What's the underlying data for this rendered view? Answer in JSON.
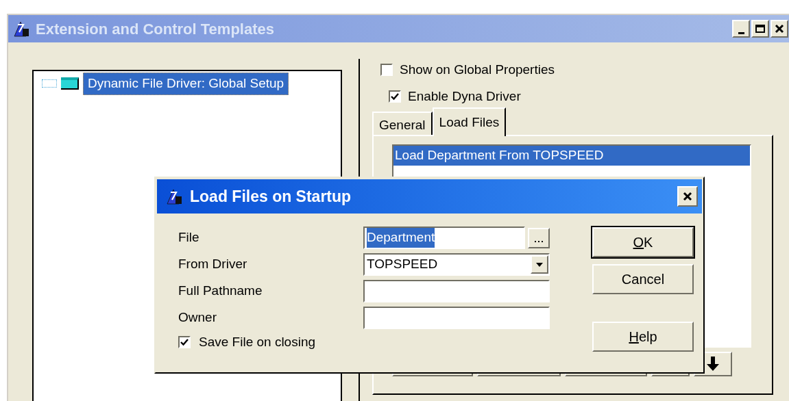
{
  "main_window": {
    "title": "Extension and Control Templates"
  },
  "tree": {
    "items": [
      {
        "label": "Dynamic File Driver: Global Setup",
        "selected": true
      }
    ]
  },
  "options": [
    {
      "label": "Show on Global Properties",
      "checked": false
    },
    {
      "label": "Enable Dyna Driver",
      "checked": true
    }
  ],
  "tabs": [
    {
      "label": "General",
      "selected": false
    },
    {
      "label": "Load Files",
      "selected": true
    }
  ],
  "load_list": {
    "items": [
      {
        "label": "Load Department From TOPSPEED",
        "selected": true
      }
    ]
  },
  "dialog": {
    "title": "Load Files on Startup",
    "fields": [
      {
        "kind": "file",
        "label": "File",
        "value": "Department",
        "value_selected": true
      },
      {
        "kind": "dropdown",
        "label": "From Driver",
        "value": "TOPSPEED",
        "value_selected": false
      },
      {
        "kind": "text",
        "label": "Full Pathname"
      },
      {
        "kind": "text",
        "label": "Owner"
      }
    ],
    "save_on_close": {
      "label": "Save File on closing",
      "checked": true
    },
    "buttons": [
      {
        "label": "OK",
        "access_key": true,
        "default": true
      },
      {
        "label": "Cancel",
        "access_key": false,
        "default": false
      },
      {
        "label": "Help",
        "access_key": true,
        "default": false
      }
    ]
  }
}
